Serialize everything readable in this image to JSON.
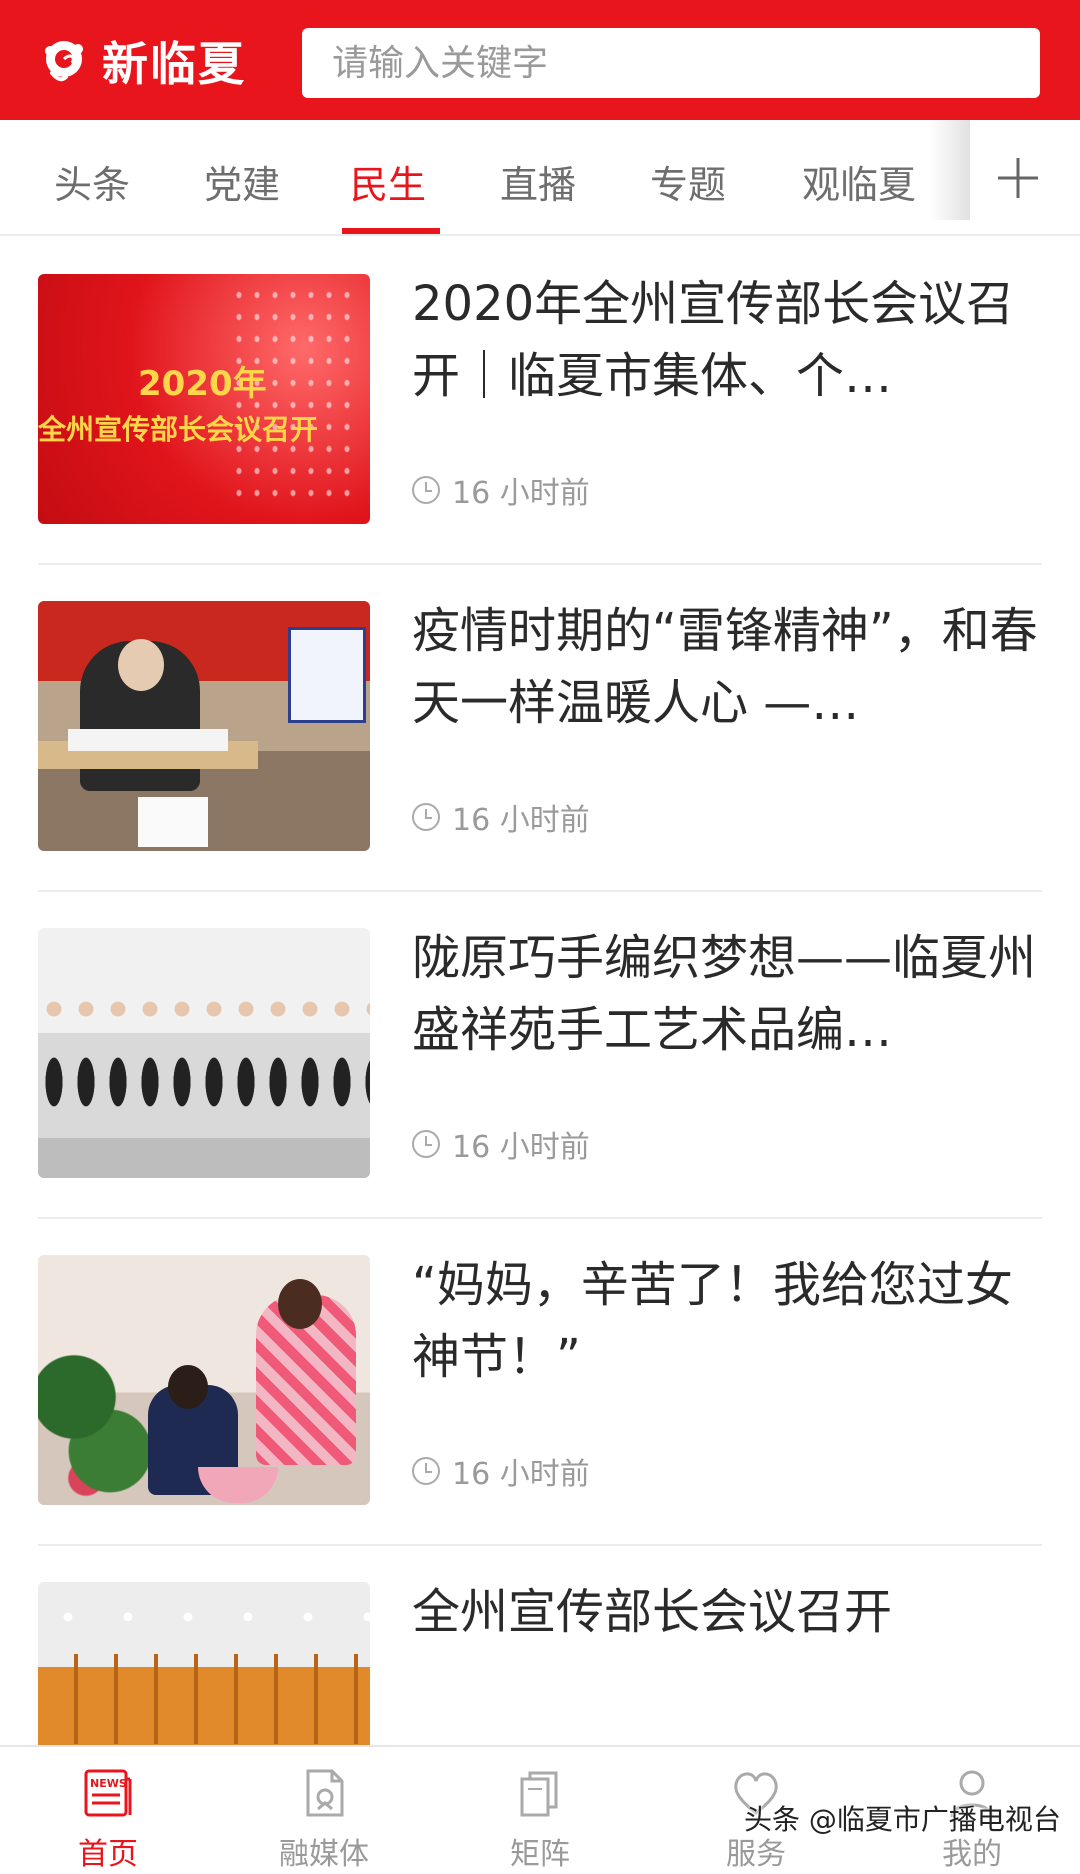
{
  "header": {
    "app_name": "新临夏",
    "search_placeholder": "请输入关键字",
    "brand_color": "#e8161c"
  },
  "tabs": {
    "items": [
      {
        "label": "头条",
        "active": false
      },
      {
        "label": "党建",
        "active": false
      },
      {
        "label": "民生",
        "active": true
      },
      {
        "label": "直播",
        "active": false
      },
      {
        "label": "专题",
        "active": false
      },
      {
        "label": "观临夏",
        "active": false
      }
    ],
    "add_icon": "plus-icon"
  },
  "feed": {
    "items": [
      {
        "title": "2020年全州宣传部长会议召开｜临夏市集体、个…",
        "time": "16 小时前",
        "thumb_text_1": "2020年",
        "thumb_text_2": "全州宣传部长会议召开"
      },
      {
        "title": "疫情时期的“雷锋精神”，和春天一样温暖人心 —…",
        "time": "16 小时前"
      },
      {
        "title": "陇原巧手编织梦想——临夏州盛祥苑手工艺术品编…",
        "time": "16 小时前"
      },
      {
        "title": "“妈妈，辛苦了！我给您过女神节！”",
        "time": "16 小时前"
      },
      {
        "title": "全州宣传部长会议召开",
        "time": ""
      }
    ]
  },
  "bottom_nav": {
    "items": [
      {
        "label": "首页",
        "icon": "news-icon",
        "active": true
      },
      {
        "label": "融媒体",
        "icon": "document-icon",
        "active": false
      },
      {
        "label": "矩阵",
        "icon": "stack-icon",
        "active": false
      },
      {
        "label": "服务",
        "icon": "heart-icon",
        "active": false
      },
      {
        "label": "我的",
        "icon": "user-icon",
        "active": false
      }
    ]
  },
  "watermark": "头条 @临夏市广播电视台"
}
